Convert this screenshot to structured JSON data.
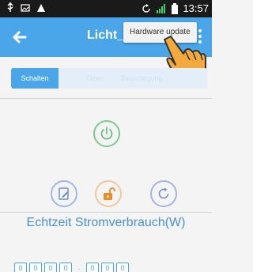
{
  "status_bar": {
    "time": "13:57"
  },
  "app_bar": {
    "title": "Licht_V",
    "menu_popup": "Hardware update"
  },
  "tabs": [
    {
      "label": "Schalten"
    },
    {
      "label": "Timer"
    },
    {
      "label": "Berechtigung"
    }
  ],
  "actions": [
    {
      "icon": "power-icon"
    },
    {
      "icon": "edit-icon"
    },
    {
      "icon": "unlock-icon"
    },
    {
      "icon": "refresh-icon"
    }
  ],
  "energy": {
    "title": "Echtzeit Stromverbrauch(W)",
    "digits": [
      "0",
      "0",
      "0",
      "0",
      ".",
      "0",
      "0",
      "0"
    ]
  },
  "colors": {
    "accent": "#4aa6e8",
    "background": "#f4f4f4",
    "power": "#7fc98f",
    "unlock": "#f08a24"
  }
}
